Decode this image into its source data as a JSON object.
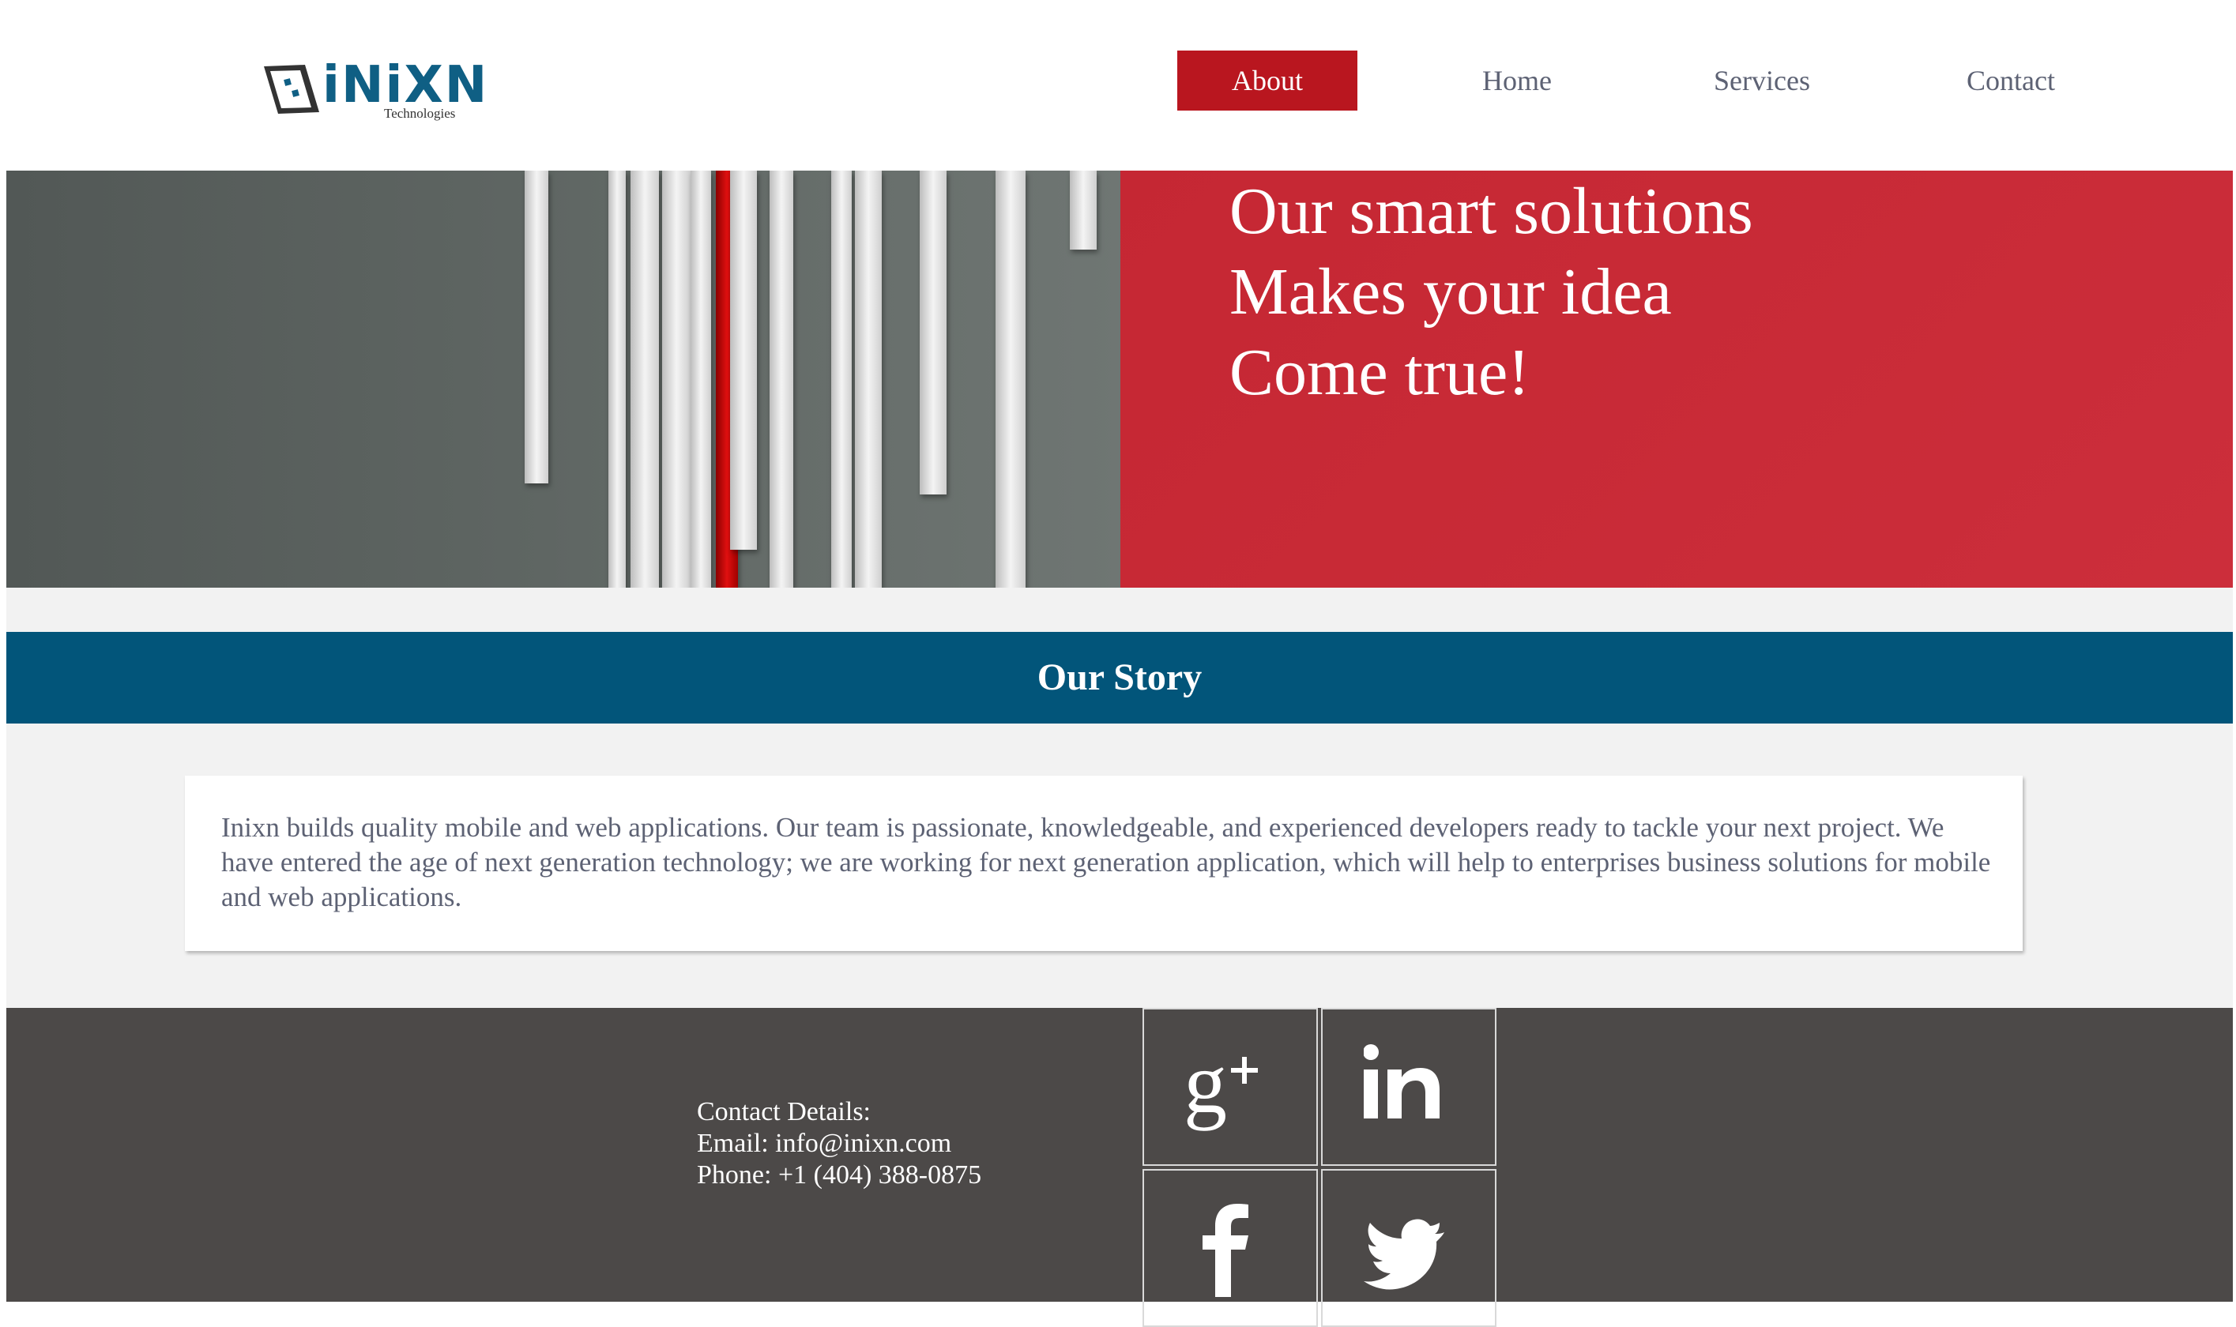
{
  "header": {
    "logo": {
      "name": "iNiXN",
      "tagline": "Technologies"
    },
    "nav": [
      {
        "label": "About",
        "active": true
      },
      {
        "label": "Home",
        "active": false
      },
      {
        "label": "Services",
        "active": false
      },
      {
        "label": "Contact",
        "active": false
      }
    ]
  },
  "hero": {
    "lines": [
      "Our smart solutions",
      "Makes your idea",
      "Come true!"
    ]
  },
  "story": {
    "title": "Our Story",
    "text": "Inixn builds quality mobile and web applications. Our team is passionate, knowledgeable, and experienced developers ready to tackle your next project. We have entered the age of next generation technology; we are working for next generation application, which will help to enterprises business solutions for mobile and web applications."
  },
  "footer": {
    "contact_heading": "Contact Details:",
    "email": "Email: info@inixn.com",
    "phone": "Phone: +1 (404) 388-0875",
    "social_icons": [
      "google-plus-icon",
      "linkedin-icon",
      "facebook-icon",
      "twitter-icon"
    ]
  },
  "colors": {
    "accent_red": "#b9161f",
    "hero_red": "#c92b37",
    "story_blue": "#02557a",
    "footer_gray": "#4c4948",
    "nav_text": "#5d6274"
  }
}
